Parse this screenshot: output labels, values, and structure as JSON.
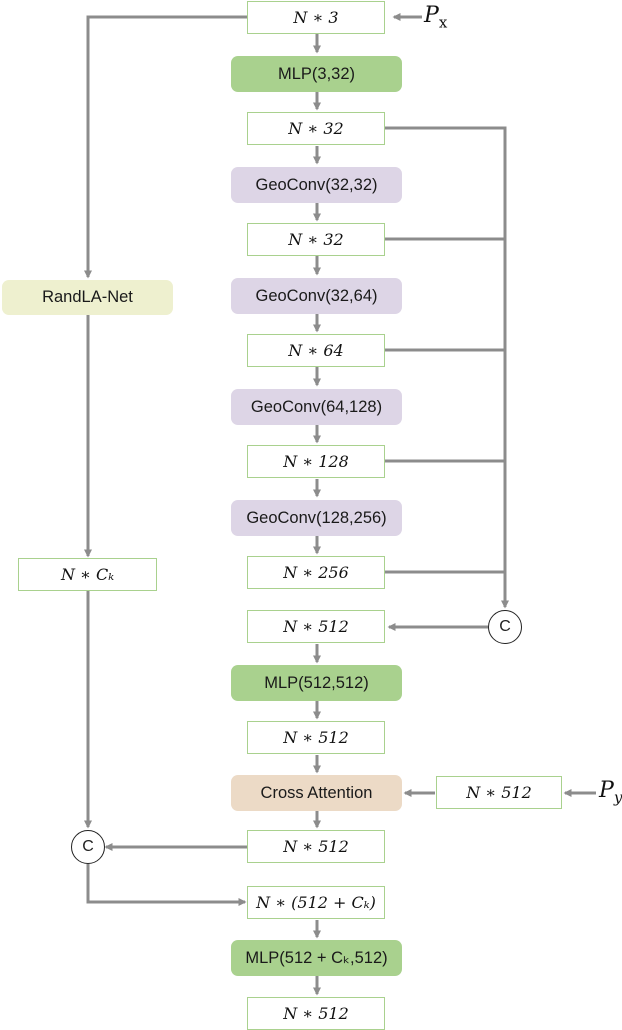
{
  "diagram": {
    "type": "neural-network-architecture-flowchart",
    "colors": {
      "wire": "#8c8c8c",
      "tensor_border": "#a9d18e",
      "mlp_fill": "#a9d18e",
      "geoconv_fill": "#ddd5e6",
      "randla_fill": "#eef0cf",
      "cross_attention_fill": "#ecdac6"
    },
    "inputs": {
      "px": {
        "symbol": "P",
        "subscript": "x"
      },
      "py": {
        "symbol": "P",
        "subscript": "y"
      }
    },
    "main_path": [
      {
        "id": "t_n3",
        "kind": "tensor",
        "label": "N ∗ 3"
      },
      {
        "id": "mlp1",
        "kind": "mlp",
        "label": "MLP(3,32)"
      },
      {
        "id": "t_n32a",
        "kind": "tensor",
        "label": "N ∗ 32"
      },
      {
        "id": "geo1",
        "kind": "geoconv",
        "label": "GeoConv(32,32)"
      },
      {
        "id": "t_n32b",
        "kind": "tensor",
        "label": "N ∗ 32"
      },
      {
        "id": "geo2",
        "kind": "geoconv",
        "label": "GeoConv(32,64)"
      },
      {
        "id": "t_n64",
        "kind": "tensor",
        "label": "N ∗ 64"
      },
      {
        "id": "geo3",
        "kind": "geoconv",
        "label": "GeoConv(64,128)"
      },
      {
        "id": "t_n128",
        "kind": "tensor",
        "label": "N ∗ 128"
      },
      {
        "id": "geo4",
        "kind": "geoconv",
        "label": "GeoConv(128,256)"
      },
      {
        "id": "t_n256",
        "kind": "tensor",
        "label": "N ∗ 256"
      },
      {
        "id": "t_n512a",
        "kind": "tensor",
        "label": "N ∗ 512"
      },
      {
        "id": "mlp2",
        "kind": "mlp",
        "label": "MLP(512,512)"
      },
      {
        "id": "t_n512b",
        "kind": "tensor",
        "label": "N ∗ 512"
      },
      {
        "id": "cross",
        "kind": "cross-attention",
        "label": "Cross Attention"
      },
      {
        "id": "t_n512c",
        "kind": "tensor",
        "label": "N ∗ 512"
      },
      {
        "id": "t_cat",
        "kind": "tensor",
        "label": "N ∗ (512 + Cₖ)"
      },
      {
        "id": "mlp3",
        "kind": "mlp",
        "label": "MLP(512 + Cₖ,512)"
      },
      {
        "id": "t_out",
        "kind": "tensor",
        "label": "N ∗ 512"
      }
    ],
    "side_nodes": {
      "randla": {
        "kind": "randla",
        "label": "RandLA-Net"
      },
      "t_nck": {
        "kind": "tensor",
        "label": "N ∗ Cₖ"
      },
      "t_py512": {
        "kind": "tensor",
        "label": "N ∗ 512"
      },
      "concat_right": {
        "kind": "concat",
        "label": "C"
      },
      "concat_left": {
        "kind": "concat",
        "label": "C"
      }
    },
    "edges": [
      [
        "px",
        "t_n3"
      ],
      [
        "t_n3",
        "mlp1"
      ],
      [
        "mlp1",
        "t_n32a"
      ],
      [
        "t_n32a",
        "geo1"
      ],
      [
        "geo1",
        "t_n32b"
      ],
      [
        "t_n32b",
        "geo2"
      ],
      [
        "geo2",
        "t_n64"
      ],
      [
        "t_n64",
        "geo3"
      ],
      [
        "geo3",
        "t_n128"
      ],
      [
        "t_n128",
        "geo4"
      ],
      [
        "geo4",
        "t_n256"
      ],
      [
        "t_n32a",
        "concat_right"
      ],
      [
        "t_n32b",
        "concat_right"
      ],
      [
        "t_n64",
        "concat_right"
      ],
      [
        "t_n128",
        "concat_right"
      ],
      [
        "t_n256",
        "concat_right"
      ],
      [
        "concat_right",
        "t_n512a"
      ],
      [
        "t_n512a",
        "mlp2"
      ],
      [
        "mlp2",
        "t_n512b"
      ],
      [
        "t_n512b",
        "cross"
      ],
      [
        "py",
        "t_py512"
      ],
      [
        "t_py512",
        "cross"
      ],
      [
        "cross",
        "t_n512c"
      ],
      [
        "t_n3",
        "randla"
      ],
      [
        "randla",
        "t_nck"
      ],
      [
        "t_nck",
        "concat_left"
      ],
      [
        "t_n512c",
        "concat_left"
      ],
      [
        "concat_left",
        "t_cat"
      ],
      [
        "t_cat",
        "mlp3"
      ],
      [
        "mlp3",
        "t_out"
      ]
    ]
  }
}
